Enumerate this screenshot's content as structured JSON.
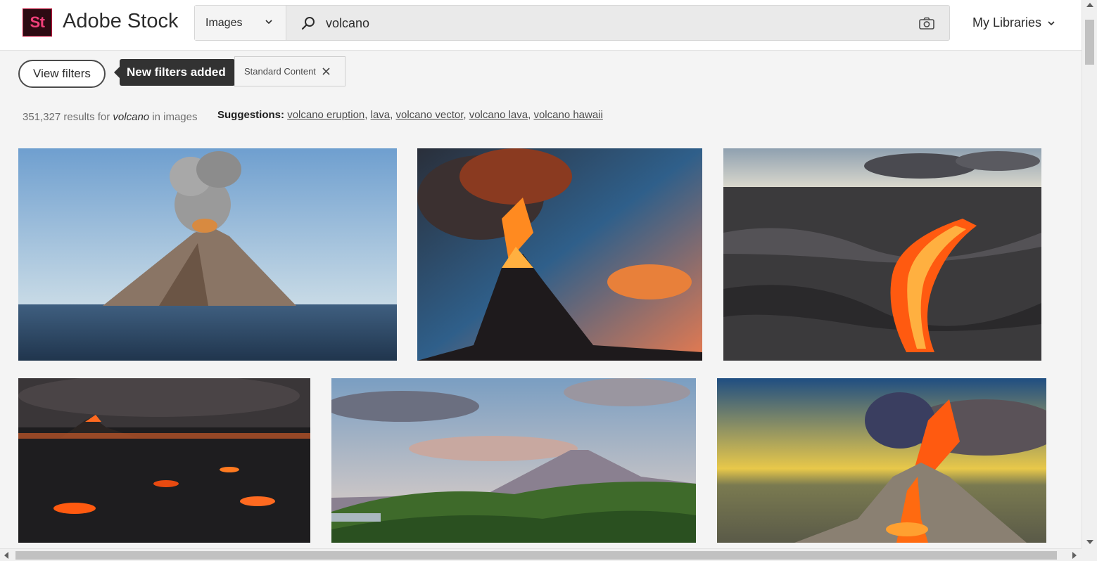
{
  "header": {
    "logo_text": "St",
    "brand": "Adobe Stock",
    "search_type": "Images",
    "query": "volcano",
    "my_libraries": "My Libraries"
  },
  "filters": {
    "view_filters": "View filters",
    "tooltip": "New filters added",
    "chip_label": "Standard Content"
  },
  "results": {
    "count": "351,327",
    "text_mid": " results for ",
    "term": "volcano",
    "text_end": " in images"
  },
  "suggestions": {
    "label": "Suggestions:",
    "items": [
      "volcano eruption",
      "lava",
      "volcano vector",
      "volcano lava",
      "volcano hawaii"
    ]
  },
  "icons": {
    "search": "search-icon",
    "camera": "camera-icon",
    "chevron": "chevron-down-icon",
    "close": "close-icon"
  },
  "colors": {
    "logo_bg": "#2d0a12",
    "logo_text": "#f0407a",
    "tooltip_bg": "#323232",
    "page_bg": "#f4f4f4"
  }
}
